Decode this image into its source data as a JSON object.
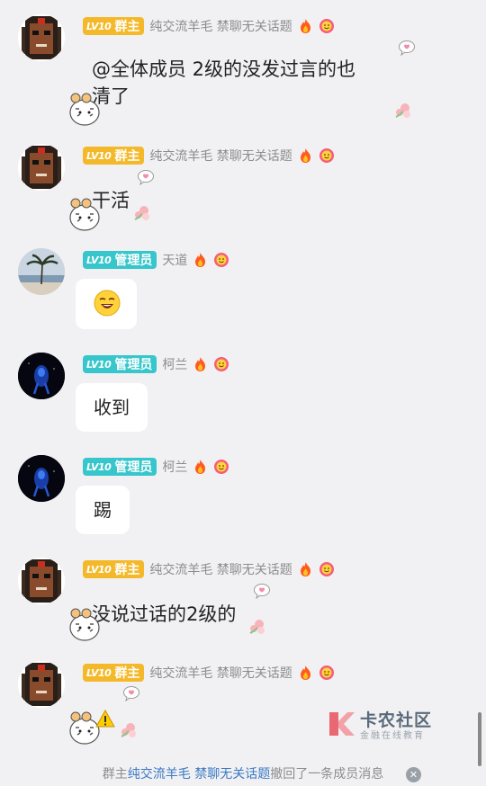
{
  "messages": [
    {
      "role_label": "群主",
      "level": "LV10",
      "name": "纯交流羊毛 禁聊无关话题",
      "text": "@全体成员 2级的没发过言的也清了",
      "line1": "@全体成员 2级的没发过言的也",
      "line2": "清了"
    },
    {
      "role_label": "群主",
      "level": "LV10",
      "name": "纯交流羊毛 禁聊无关话题",
      "text": "干活"
    },
    {
      "role_label": "管理员",
      "level": "LV10",
      "name": "天道",
      "sticker": "grinning-face-emoji"
    },
    {
      "role_label": "管理员",
      "level": "LV10",
      "name": "柯兰",
      "text": "收到"
    },
    {
      "role_label": "管理员",
      "level": "LV10",
      "name": "柯兰",
      "text": "踢"
    },
    {
      "role_label": "群主",
      "level": "LV10",
      "name": "纯交流羊毛 禁聊无关话题",
      "text": "没说过话的2级的"
    },
    {
      "role_label": "群主",
      "level": "LV10",
      "name": "纯交流羊毛 禁聊无关话题",
      "text": ""
    }
  ],
  "notice": {
    "prefix": "群主",
    "highlight": "纯交流羊毛 禁聊无关话题",
    "suffix": "撤回了一条成员消息"
  },
  "watermark": {
    "title": "卡农社区",
    "subtitle": "金融在线教育"
  },
  "colors": {
    "owner_tag": "#f4b92b",
    "admin_tag": "#37c6cc",
    "link": "#3a79c4",
    "background": "#f1f1f3"
  }
}
